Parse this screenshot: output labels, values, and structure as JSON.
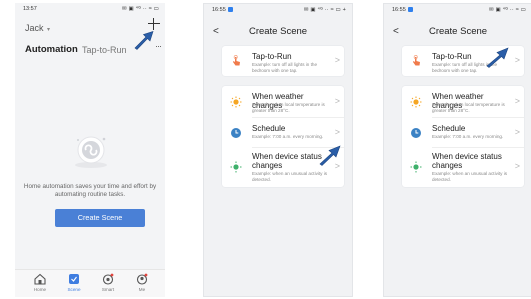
{
  "phone1": {
    "status": {
      "time": "13:57",
      "icons": "✉ ▣ ⁴ᴳ ·· ≈ ▭"
    },
    "home_name": "Jack",
    "home_chevron": "▾",
    "tabs": [
      "Automation",
      "Tap-to-Run"
    ],
    "more": "···",
    "empty_text": "Home automation saves your time and effort by automating routine tasks.",
    "create_button": "Create Scene",
    "tabbar": [
      "Home",
      "Scene",
      "Smart",
      "Me"
    ]
  },
  "phone2": {
    "status": {
      "time": "16:55",
      "icons": "✉ ▣ ⁴ᴳ ·· ≈ ▭ +"
    },
    "back": "<",
    "title": "Create Scene",
    "items": [
      {
        "title": "Tap-to-Run",
        "desc": "Example: turn off all lights in the bedroom with one tap."
      },
      {
        "title": "When weather changes",
        "desc": "Example: when local temperature is greater than 28°C."
      },
      {
        "title": "Schedule",
        "desc": "Example: 7:00 a.m. every morning."
      },
      {
        "title": "When device status changes",
        "desc": "Example: when an unusual activity is detected."
      }
    ],
    "chevron": ">"
  },
  "phone3": {
    "status": {
      "time": "16:55",
      "icons": "✉ ▣ ⁴ᴳ ·· ≈ ▭"
    },
    "back": "<",
    "title": "Create Scene",
    "items": [
      {
        "title": "Tap-to-Run",
        "desc": "Example: turn off all lights in the bedroom with one tap."
      },
      {
        "title": "When weather changes",
        "desc": "Example: when local temperature is greater than 28°C."
      },
      {
        "title": "Schedule",
        "desc": "Example: 7:00 a.m. every morning."
      },
      {
        "title": "When device status changes",
        "desc": "Example: when an unusual activity is detected."
      }
    ],
    "chevron": ">"
  },
  "colors": {
    "accent": "#4a80d6",
    "annotation_arrow": "#2a5ea8",
    "tap_icon": "#f07b4c",
    "weather_icon": "#f5a623",
    "schedule_icon": "#3b82c4",
    "device_icon": "#3fb06b"
  },
  "icons": [
    "plus-icon",
    "annotation-arrow-icon",
    "tap-hand-icon",
    "sun-icon",
    "clock-icon",
    "device-status-icon",
    "home-icon",
    "scene-icon",
    "smart-icon",
    "me-icon"
  ]
}
